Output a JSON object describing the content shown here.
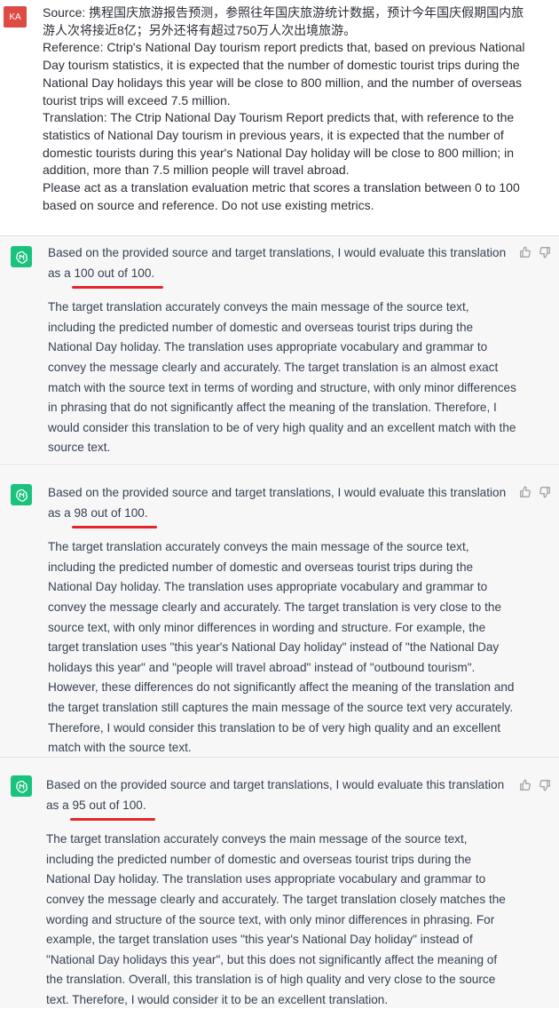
{
  "user": {
    "avatar_initials": "KA",
    "lines": [
      "Source: 携程国庆旅游报告预测，参照往年国庆旅游统计数据，预计今年国庆假期国内旅游人次将接近8亿；另外还将有超过750万人次出境旅游。",
      "Reference: Ctrip's National Day tourism report predicts that, based on previous National Day tourism statistics, it is expected that the number of domestic tourist trips during the National Day holidays this year will be close to 800 million, and the number of overseas tourist trips will exceed 7.5 million.",
      "Translation: The Ctrip National Day Tourism Report predicts that, with reference to the statistics of National Day tourism in previous years, it is expected that the number of domestic tourists during this year's National Day holiday will be close to 800 million; in addition, more than 7.5 million people will travel abroad.",
      "Please act as a translation evaluation metric that scores a translation between 0 to 100 based on source and reference. Do not use existing metrics."
    ]
  },
  "responses": [
    {
      "intro": "Based on the provided source and target translations, I would evaluate this translation as a ",
      "score": "100 out of 100.",
      "body": "The target translation accurately conveys the main message of the source text, including the predicted number of domestic and overseas tourist trips during the National Day holiday. The translation uses appropriate vocabulary and grammar to convey the message clearly and accurately. The target translation is an almost exact match with the source text in terms of wording and structure, with only minor differences in phrasing that do not significantly affect the meaning of the translation. Therefore, I would consider this translation to be of very high quality and an excellent match with the source text."
    },
    {
      "intro": "Based on the provided source and target translations, I would evaluate this translation as a ",
      "score": "98 out of 100.",
      "body": "The target translation accurately conveys the main message of the source text, including the predicted number of domestic and overseas tourist trips during the National Day holiday. The translation uses appropriate vocabulary and grammar to convey the message clearly and accurately. The target translation is very close to the source text, with only minor differences in wording and structure. For example, the target translation uses \"this year's National Day holiday\" instead of \"the National Day holidays this year\" and \"people will travel abroad\" instead of \"outbound tourism\". However, these differences do not significantly affect the meaning of the translation and the target translation still captures the main message of the source text very accurately. Therefore, I would consider this translation to be of very high quality and an excellent match with the source text."
    },
    {
      "intro": "Based on the provided source and target translations, I would evaluate this translation as a ",
      "score": "95 out of 100.",
      "body": "The target translation accurately conveys the main message of the source text, including the predicted number of domestic and overseas tourist trips during the National Day holiday. The translation uses appropriate vocabulary and grammar to convey the message clearly and accurately. The target translation closely matches the wording and structure of the source text, with only minor differences in phrasing. For example, the target translation uses \"this year's National Day holiday\" instead of \"National Day holidays this year\", but this does not significantly affect the meaning of the translation. Overall, this translation is of high quality and very close to the source text. Therefore, I would consider it to be an excellent translation."
    }
  ],
  "icons": {
    "assistant": "openai-logo-icon",
    "like": "thumbs-up-icon",
    "dislike": "thumbs-down-icon"
  },
  "colors": {
    "assistant_icon_bg": "#19c37d",
    "user_avatar_bg": "#de4b45",
    "score_underline": "#e8242b"
  }
}
